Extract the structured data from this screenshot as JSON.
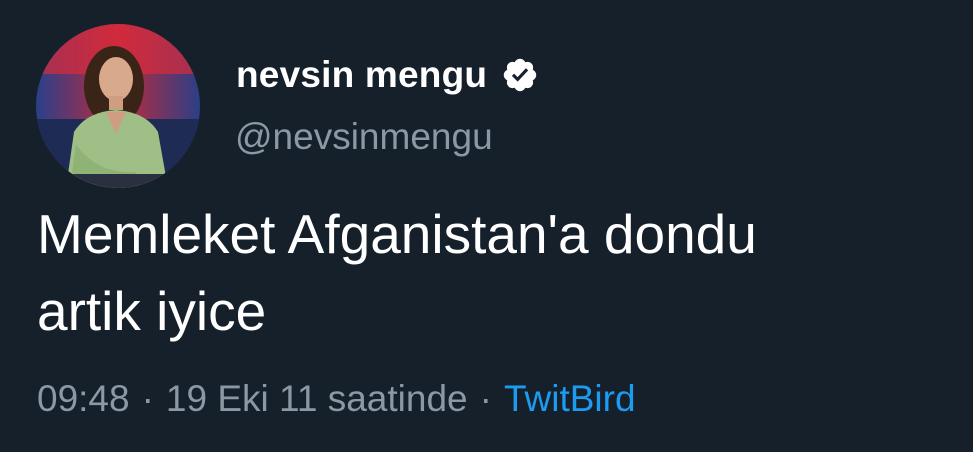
{
  "user": {
    "display_name": "nevsin mengu",
    "handle": "@nevsinmengu",
    "verified": true,
    "avatar_icon": "profile-photo"
  },
  "tweet": {
    "text_line_1": "Memleket Afganistan'a dondu",
    "text_line_2": "artik iyice"
  },
  "meta": {
    "time": "09:48",
    "separator": "·",
    "date": "19 Eki 11 saatinde",
    "source": "TwitBird"
  },
  "colors": {
    "background": "#15202b",
    "text": "#ffffff",
    "muted": "#8b98a5",
    "link": "#1d9bf0"
  }
}
